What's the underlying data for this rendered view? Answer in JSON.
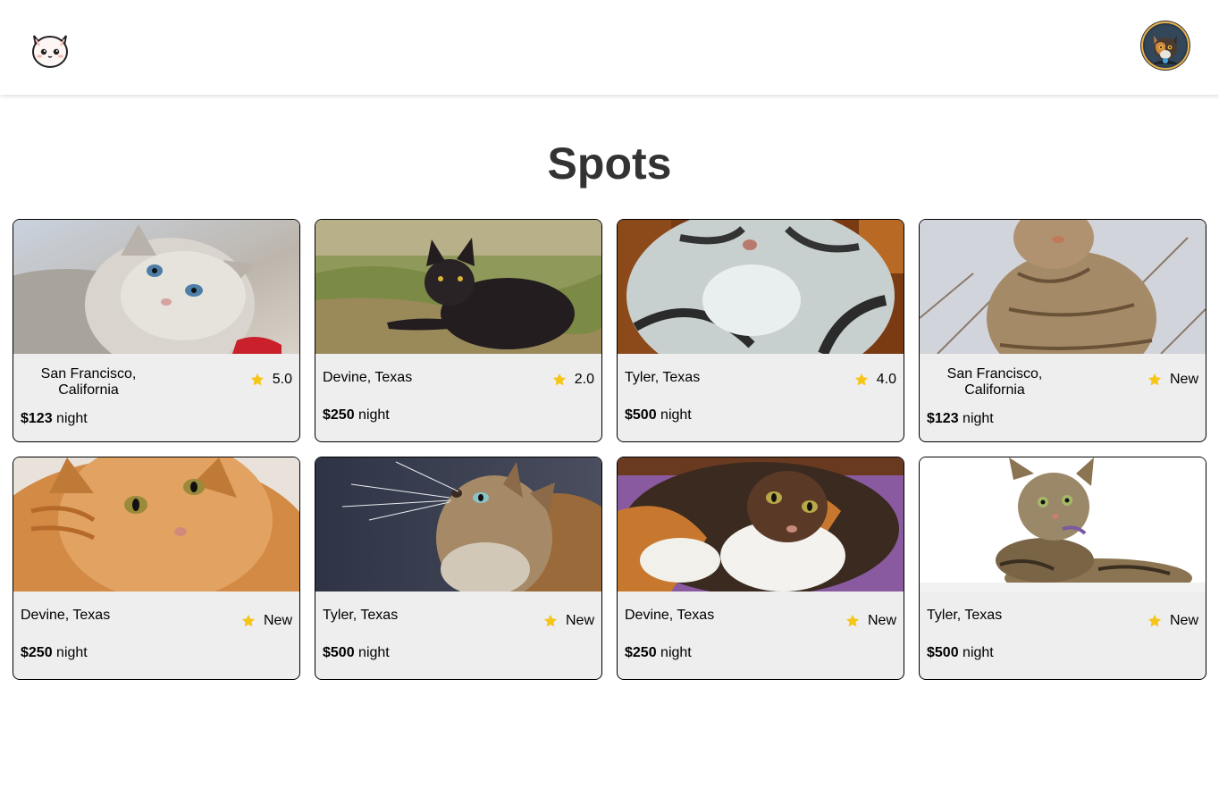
{
  "header": {
    "logo_icon": "cat-face-logo-icon",
    "avatar_icon": "user-avatar-cat-icon"
  },
  "page": {
    "title": "Spots"
  },
  "colors": {
    "star": "#f5c518",
    "card_bg": "#eeeeee",
    "title": "#333333"
  },
  "spots": [
    {
      "location": "San Francisco, California",
      "rating": "5.0",
      "price": "$123",
      "unit": "night",
      "photo": "fluffy-gray-cat-blue-eyes"
    },
    {
      "location": "Devine, Texas",
      "rating": "2.0",
      "price": "$250",
      "unit": "night",
      "photo": "black-cat-on-grass"
    },
    {
      "location": "Tyler, Texas",
      "rating": "4.0",
      "price": "$500",
      "unit": "night",
      "photo": "silver-tabby-cat-closeup"
    },
    {
      "location": "San Francisco, California",
      "rating": "New",
      "price": "$123",
      "unit": "night",
      "photo": "brown-tabby-cat-sitting"
    },
    {
      "location": "Devine, Texas",
      "rating": "New",
      "price": "$250",
      "unit": "night",
      "photo": "orange-cat-closeup"
    },
    {
      "location": "Tyler, Texas",
      "rating": "New",
      "price": "$500",
      "unit": "night",
      "photo": "long-haired-tabby-looking-up"
    },
    {
      "location": "Devine, Texas",
      "rating": "New",
      "price": "$250",
      "unit": "night",
      "photo": "calico-cat-on-purple"
    },
    {
      "location": "Tyler, Texas",
      "rating": "New",
      "price": "$500",
      "unit": "night",
      "photo": "bengal-kitten-lying"
    }
  ]
}
